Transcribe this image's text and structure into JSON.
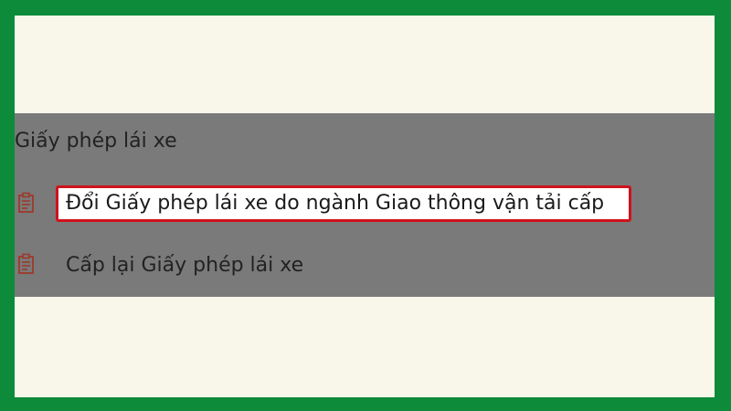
{
  "section": {
    "title": "Giấy phép lái xe"
  },
  "items": [
    {
      "label": "Đổi Giấy phép lái xe do ngành Giao thông vận tải cấp",
      "icon": "clipboard-document-icon",
      "highlighted": true
    },
    {
      "label": "Cấp lại Giấy phép lái xe",
      "icon": "clipboard-document-icon",
      "highlighted": false
    }
  ],
  "colors": {
    "frame": "#0d8a3a",
    "background": "#f9f7ea",
    "panel": "#7a7a7a",
    "highlight_border": "#d0121b",
    "icon": "#9c3a2a"
  }
}
